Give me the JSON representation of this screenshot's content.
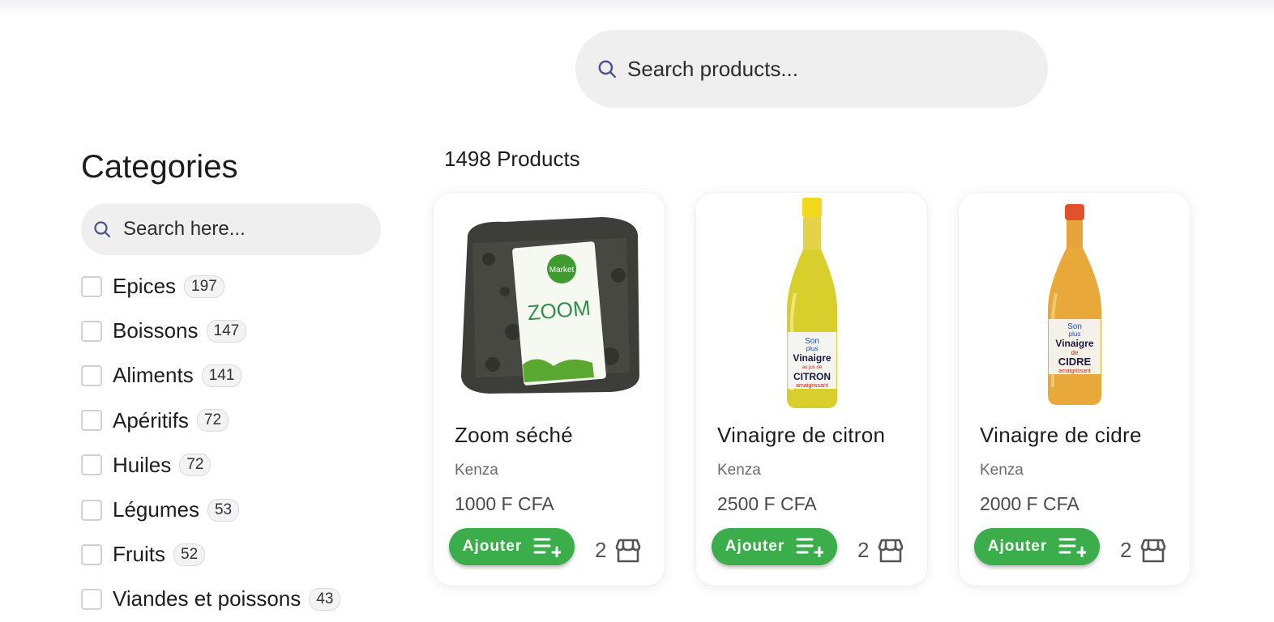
{
  "search": {
    "placeholder": "Search products..."
  },
  "sidebar": {
    "title": "Categories",
    "search_placeholder": "Search here...",
    "categories": [
      {
        "label": "Epices",
        "count": "197"
      },
      {
        "label": "Boissons",
        "count": "147"
      },
      {
        "label": "Aliments",
        "count": "141"
      },
      {
        "label": "Apéritifs",
        "count": "72"
      },
      {
        "label": "Huiles",
        "count": "72"
      },
      {
        "label": "Légumes",
        "count": "53"
      },
      {
        "label": "Fruits",
        "count": "52"
      },
      {
        "label": "Viandes et poissons",
        "count": "43"
      }
    ]
  },
  "results": {
    "count_label": "1498 Products"
  },
  "products": [
    {
      "name": "Zoom séché",
      "brand": "Kenza",
      "price": "1000 F CFA",
      "button": "Ajouter",
      "stock": "2"
    },
    {
      "name": "Vinaigre de citron",
      "brand": "Kenza",
      "price": "2500 F CFA",
      "button": "Ajouter",
      "stock": "2"
    },
    {
      "name": "Vinaigre de cidre",
      "brand": "Kenza",
      "price": "2000 F CFA",
      "button": "Ajouter",
      "stock": "2"
    }
  ],
  "product_images": [
    {
      "icon": "herb-bag-image",
      "label": "ZOOM",
      "badge": "Market"
    },
    {
      "icon": "vinegar-bottle-image",
      "label_lines": [
        "Son",
        "plus",
        "Vinaigre",
        "au jus de",
        "CITRON",
        "amaigrissant"
      ]
    },
    {
      "icon": "vinegar-bottle-image",
      "label_lines": [
        "Son",
        "plus",
        "Vinaigre",
        "de",
        "CIDRE",
        "amaigrissant"
      ]
    }
  ],
  "colors": {
    "accent": "#3bae4b",
    "search_bg": "#efefef",
    "icon": "#4a4f8f"
  }
}
